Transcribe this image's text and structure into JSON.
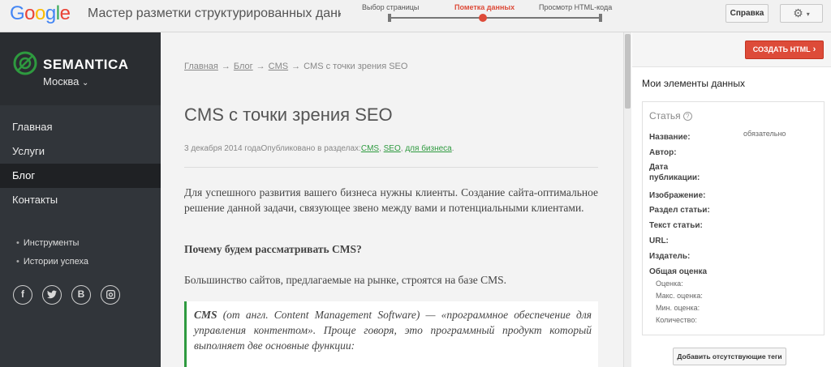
{
  "topbar": {
    "logo": [
      "G",
      "o",
      "o",
      "g",
      "l",
      "e"
    ],
    "logo_colors": [
      "#4285f4",
      "#ea4335",
      "#fbbc05",
      "#4285f4",
      "#34a853",
      "#ea4335"
    ],
    "tool_title": "Мастер разметки структурированных данны",
    "steps": [
      {
        "label": "Выбор страницы",
        "active": false
      },
      {
        "label": "Пометка данных",
        "active": true
      },
      {
        "label": "Просмотр HTML-кода",
        "active": false
      }
    ],
    "help_label": "Справка"
  },
  "sidebar": {
    "brand": "SEMANTICA",
    "city": "Москва",
    "nav": [
      {
        "label": "Главная",
        "active": false
      },
      {
        "label": "Услуги",
        "active": false
      },
      {
        "label": "Блог",
        "active": true
      },
      {
        "label": "Контакты",
        "active": false
      }
    ],
    "sub_links": [
      "Инструменты",
      "Истории успеха"
    ],
    "social": [
      "f",
      "t",
      "B",
      "ig"
    ]
  },
  "article": {
    "breadcrumb": [
      "Главная",
      "Блог",
      "CMS",
      "CMS с точки зрения SEO"
    ],
    "title": "CMS с точки зрения SEO",
    "meta_date": "3 декабря 2014 годаОпубликовано в разделах:",
    "meta_links": [
      "CMS",
      "SEO",
      "для бизнеса"
    ],
    "para1": "Для успешного развития вашего бизнеса нужны клиенты. Создание сайта-оптимальное решение данной задачи, связующее звено между вами и потенциальными клиентами.",
    "heading2": "Почему будем рассматривать CMS?",
    "para2": "Большинство сайтов, предлагаемые на рынке, строятся на базе CMS.",
    "quote_term": "CMS",
    "quote_rest": " (от англ. Content Management Software) — «программное обеспечение для управления контентом». Проще говоря, это программный продукт который выполняет две основные функции:",
    "accent_color": "#2e9a3f"
  },
  "panel": {
    "create_label": "СОЗДАТЬ HTML",
    "heading": "Мои элементы данных",
    "box_title": "Статья",
    "required_note": "обязательно",
    "fields": [
      "Название:",
      "Автор:",
      "Дата публикации:",
      "Изображение:",
      "Раздел статьи:",
      "Текст статьи:",
      "URL:",
      "Издатель:",
      "Общая оценка"
    ],
    "subfields": [
      "Оценка:",
      "Макс. оценка:",
      "Мин. оценка:",
      "Количество:"
    ],
    "add_tags_label": "Добавить отсутствующие теги",
    "accent_color": "#dd4b39"
  }
}
